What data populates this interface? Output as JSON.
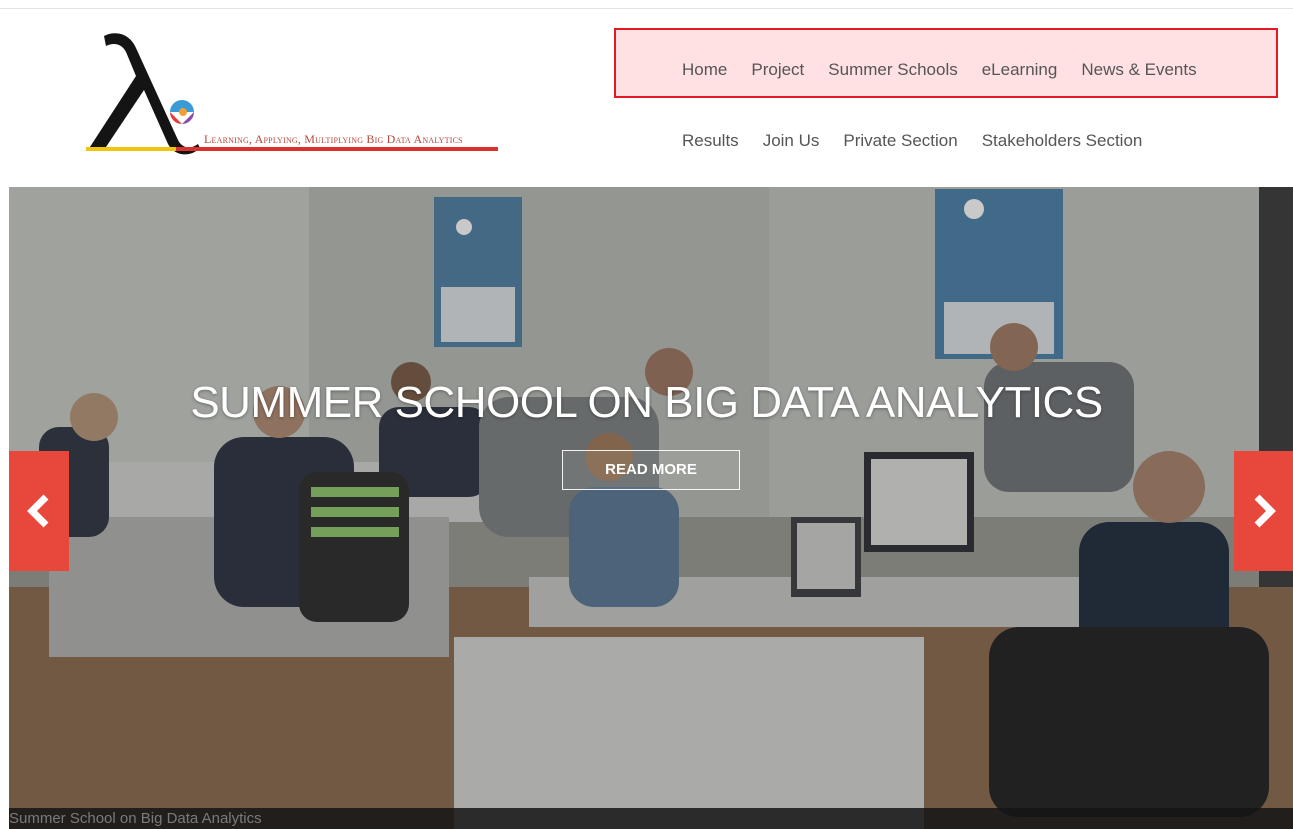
{
  "logo": {
    "symbol": "λe",
    "tagline": "Learning, Applying, Multiplying Big Data Analytics"
  },
  "nav": {
    "row1": [
      "Home",
      "Project",
      "Summer Schools",
      "eLearning",
      "News & Events"
    ],
    "row2": [
      "Results",
      "Join Us",
      "Private Section",
      "Stakeholders Section"
    ]
  },
  "hero": {
    "title": "SUMMER SCHOOL ON BIG DATA ANALYTICS",
    "button": "READ MORE",
    "caption": "Summer School on Big Data Analytics",
    "prev_icon": "chevron-left-icon",
    "next_icon": "chevron-right-icon"
  },
  "colors": {
    "nav_highlight_border": "#e01b24",
    "nav_highlight_bg": "#ffe0e3",
    "arrow_bg": "#e8473c"
  }
}
